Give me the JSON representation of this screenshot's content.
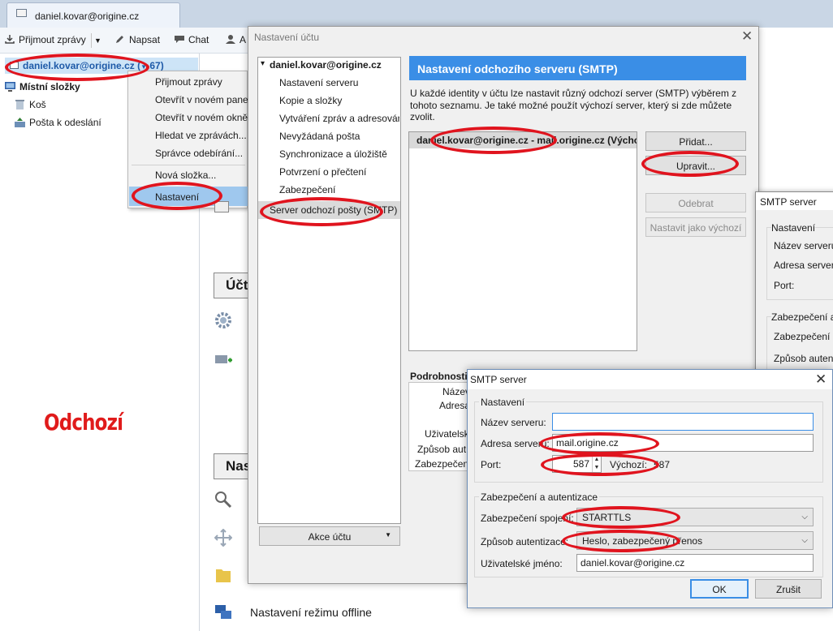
{
  "tab": {
    "title": "daniel.kovar@origine.cz"
  },
  "toolbar": {
    "get_messages": "Přijmout zprávy",
    "write": "Napsat",
    "chat": "Chat",
    "address_book_partial": "A"
  },
  "folders": {
    "account": "daniel.kovar@origine.cz (",
    "account_count": "67)",
    "local_folders": "Místní složky",
    "trash": "Koš",
    "outbox": "Pošta k odeslání"
  },
  "context_menu": {
    "items": [
      "Přijmout zprávy",
      "Otevřít v novém panelu",
      "Otevřít v novém okně",
      "Hledat ve zprávách...",
      "Správce odebírání...",
      "Nová složka...",
      "Nastavení"
    ],
    "selected": "Nastavení"
  },
  "annotation": {
    "label": "Odchozí"
  },
  "background_pane": {
    "accounts_btn": "Účt",
    "search_btn": "Nas",
    "offline_label": "Nastavení režimu offline"
  },
  "account_settings": {
    "title": "Nastavení účtu",
    "account": "daniel.kovar@origine.cz",
    "tree": [
      "Nastavení serveru",
      "Kopie a složky",
      "Vytváření zpráv a adresování",
      "Nevyžádaná pošta",
      "Synchronizace a úložiště",
      "Potvrzení o přečtení",
      "Zabezpečení",
      "Server odchozí pošty (SMTP)"
    ],
    "account_actions": "Akce účtu",
    "smtp_header": "Nastavení odchozího serveru (SMTP)",
    "smtp_desc": "U každé identity v účtu lze nastavit různý odchozí server (SMTP) výběrem z tohoto seznamu. Je také možné použít výchozí server, který si zde můžete zvolit.",
    "smtp_entry": "daniel.kovar@origine.cz - mail.origine.cz (Výchozí)",
    "buttons": {
      "add": "Přidat...",
      "edit": "Upravit...",
      "remove": "Odebrat",
      "set_default": "Nastavit jako výchozí"
    },
    "details": {
      "label": "Podrobnosti",
      "rows": [
        "Název",
        "Adresa",
        "Uživatelsk",
        "Způsob aut",
        "Zabezpečen"
      ]
    }
  },
  "smtp_dialog_back": {
    "title": "SMTP server",
    "settings_group": "Nastavení",
    "server_name": "Název serveru",
    "server_address": "Adresa serveru",
    "port": "Port:",
    "security_group": "Zabezpečení a",
    "conn_security": "Zabezpečení s",
    "auth_method": "Způsob auten"
  },
  "smtp_dialog": {
    "title": "SMTP server",
    "settings_group": "Nastavení",
    "server_name_label": "Název serveru:",
    "server_name_value": "",
    "server_address_label": "Adresa serveru:",
    "server_address_value": "mail.origine.cz",
    "port_label": "Port:",
    "port_value": "587",
    "default_label": "Výchozí:",
    "default_value": "587",
    "security_group": "Zabezpečení a autentizace",
    "conn_security_label": "Zabezpečení spojení:",
    "conn_security_value": "STARTTLS",
    "auth_method_label": "Způsob autentizace:",
    "auth_method_value": "Heslo, zabezpečený přenos",
    "username_label": "Uživatelské jméno:",
    "username_value": "daniel.kovar@origine.cz",
    "ok": "OK",
    "cancel": "Zrušit"
  },
  "colors": {
    "accent": "#3a8ee6",
    "annotation": "#e0141e",
    "selection": "#9fc8ee"
  }
}
